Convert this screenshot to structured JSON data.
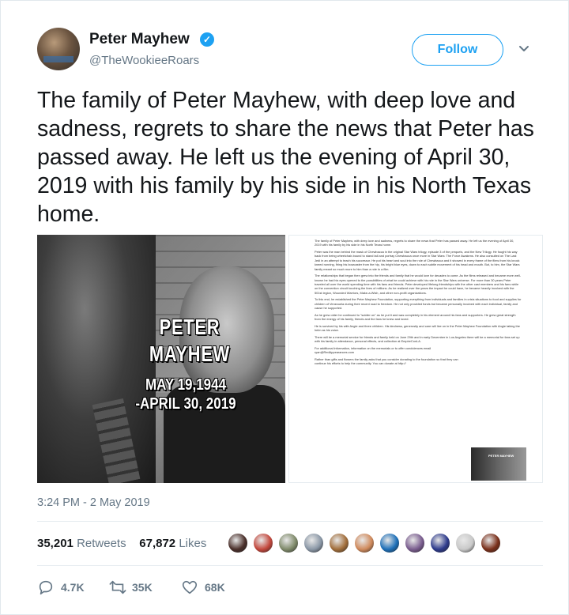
{
  "user": {
    "name": "Peter Mayhew",
    "handle": "@TheWookieeRoars",
    "verified_icon": "verified-badge-icon",
    "follow_label": "Follow"
  },
  "tweet": {
    "text": "The family of Peter Mayhew, with deep love and sadness, regrets to share the news that Peter has passed away.  He left us the evening of April 30, 2019 with his family by his side in his North Texas home.",
    "timestamp": "3:24 PM - 2 May 2019"
  },
  "media": {
    "photo": {
      "name_line1": "PETER",
      "name_line2": "MAYHEW",
      "dates_line1": "MAY 19,1944",
      "dates_line2": "-APRIL 30, 2019"
    },
    "letter": {
      "paragraphs": [
        "The family of Peter Mayhew, with deep love and sadness, regrets to share the news that Peter has passed away. He left us the evening of April 30, 2019 with his family by his side in his North Texas home.",
        "Peter was the man behind the mask of Chewbacca in the original Star Wars trilogy, episode 3 of the prequels, and the New Trilogy. He fought his way back from being wheelchair-bound to stand tall and portray Chewbacca once more in Star Wars: The Force Awakens. He also consulted on The Last Jedi in an attempt to teach his successor. He put his heart and soul into the role of Chewbacca and it showed in every frame of the films from his knock kneed running, firing his bowcaster from the hip, his bright blue eyes, down to each subtle movement of his head and mouth. But, to him, the Star Wars family meant so much more to him than a role in a film.",
        "The relationships that began then grew into the friends and family that he would love for decades to come. As the films released and became more well-known he had his eyes opened to the possibilities of what he could achieve with his role in the Star Wars universe. For more than 30 years Peter traveled all over the world spending time with his fans and friends. Peter developed lifelong friendships with the other cast members and his fans while on the convention circuit touching the lives of millions. As he realized over the years the impact he could have, he became heavily involved with the 501st legion, Wounded Warriors, Make-a-Wish, and other non-profit organizations.",
        "To this end, he established the Peter Mayhew Foundation, supporting everything from individuals and families in crisis situations to food and supplies for children of Venezuela during their recent road to freedom. He not only provided funds but became personally involved with each individual, family and cause he supported.",
        "As he grew older he continued to \"soldier on\" as he put it and was completely in his element around his fans and supporters. He grew great strength from the energy of his family, friends and the fans he knew and loved.",
        "He is survived by his wife Angie and three children. His kindness, generosity and care will live on in the Peter Mayhew Foundation with Angie taking the helm as his voice.",
        "There will be a memorial service for friends and family held on June 29th and in early December in Los Angeles there will be a memorial for fans set up with his family in attendance, personal effects, and collection at EmpireConLA.",
        "For additional information, information on the memorials or to offer condolences email ryan@RedAppearances.com",
        "Rather than gifts and flowers the family asks that you consider donating to the foundation so that they can continue his efforts to help the community. You can donate at http://"
      ],
      "thumb_text": "PETER MAYHEW"
    }
  },
  "stats": {
    "retweets_count": "35,201",
    "retweets_label": "Retweets",
    "likes_count": "67,872",
    "likes_label": "Likes"
  },
  "actions": {
    "reply_count": "4.7K",
    "retweet_count": "35K",
    "like_count": "68K"
  },
  "colors": {
    "accent": "#1da1f2",
    "text": "#14171a",
    "muted": "#657786",
    "divider": "#e6ecf0"
  },
  "liker_colors": [
    "#4a2f2a",
    "#c3473c",
    "#7f8a6a",
    "#8a97a6",
    "#a26e3b",
    "#d08a5c",
    "#1d6fb8",
    "#7a5d8f",
    "#2d3a8c",
    "#c9c9c9",
    "#7a2f1a"
  ]
}
